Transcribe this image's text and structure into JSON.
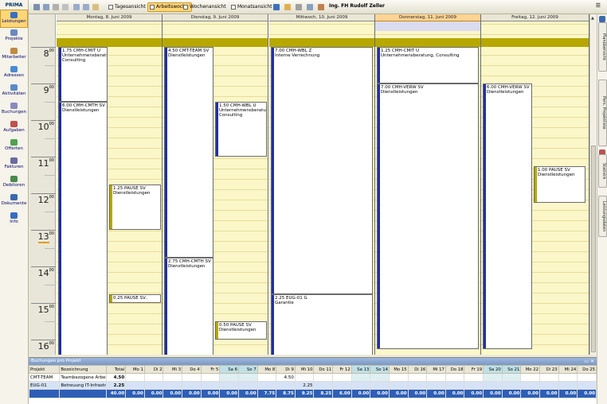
{
  "app": {
    "title": "PRIMA",
    "user": "Ing. FH Rudolf Zeller"
  },
  "sidebar": {
    "items": [
      {
        "label": "Leistungen",
        "icon": "leistungen-icon",
        "selected": true
      },
      {
        "label": "Projekte",
        "icon": "projekte-icon"
      },
      {
        "label": "Mitarbeiter",
        "icon": "mitarbeiter-icon"
      },
      {
        "label": "Adressen",
        "icon": "adressen-icon"
      },
      {
        "label": "Aktivitäten",
        "icon": "aktivitaeten-icon"
      },
      {
        "label": "Buchungen",
        "icon": "buchungen-icon"
      },
      {
        "label": "Aufgaben",
        "icon": "aufgaben-icon"
      },
      {
        "label": "Offerten",
        "icon": "offerten-icon"
      },
      {
        "label": "Fakturen",
        "icon": "fakturen-icon"
      },
      {
        "label": "Debitoren",
        "icon": "debitoren-icon"
      },
      {
        "label": "Dokumente",
        "icon": "dokumente-icon"
      },
      {
        "label": "Info",
        "icon": "info-icon"
      }
    ]
  },
  "toolbar": {
    "views": [
      "Tagesansicht",
      "Arbeitswoche",
      "Wochenansicht",
      "Monatsansicht"
    ],
    "selected_view": "Arbeitswoche",
    "menu_glyph": "☰"
  },
  "calendar": {
    "days": [
      {
        "label": "Montag, 8. Juni 2009",
        "today": false
      },
      {
        "label": "Dienstag, 9. Juni 2009",
        "today": false
      },
      {
        "label": "Mittwoch, 10. Juni 2009",
        "today": false
      },
      {
        "label": "Donnerstag, 11. Juni 2009",
        "today": true
      },
      {
        "label": "Freitag, 12. Juni 2009",
        "today": false
      }
    ],
    "hours": [
      {
        "h": "8",
        "m": "00"
      },
      {
        "h": "9",
        "m": "00"
      },
      {
        "h": "10",
        "m": "00"
      },
      {
        "h": "11",
        "m": "00"
      },
      {
        "h": "12",
        "m": "00"
      },
      {
        "h": "13",
        "m": "00"
      },
      {
        "h": "14",
        "m": "00"
      },
      {
        "h": "15",
        "m": "00"
      },
      {
        "h": "16",
        "m": "00"
      }
    ],
    "current_hour": "13",
    "appointments": [
      {
        "day": 0,
        "sub": 0,
        "start": 8,
        "end": 9.5,
        "title": "1.75 CMH-CMIT U",
        "desc": "Unternehmensberatung, Consulting"
      },
      {
        "day": 0,
        "sub": 0,
        "start": 9.5,
        "end": 16.5,
        "title": "6.00 CMH-CMTH SV",
        "desc": "Dienstleistungen"
      },
      {
        "day": 0,
        "sub": 1,
        "start": 11.75,
        "end": 13.0,
        "title": "1.25 PAUSE SV",
        "desc": "Dienstleistungen",
        "color": "#b6a800"
      },
      {
        "day": 0,
        "sub": 1,
        "start": 14.75,
        "end": 15.0,
        "title": "0.25 PAUSE SV..",
        "desc": "",
        "color": "#b6a800"
      },
      {
        "day": 1,
        "sub": 0,
        "start": 8,
        "end": 13.75,
        "title": "4.50 CMT-TEAM SV",
        "desc": "Dienstleistungen"
      },
      {
        "day": 1,
        "sub": 1,
        "start": 9.5,
        "end": 11.0,
        "title": "1.50 CMH-WBL U",
        "desc": "Unternehmensberatung, Consulting"
      },
      {
        "day": 1,
        "sub": 0,
        "start": 13.75,
        "end": 16.5,
        "title": "2.75 CMH-CMTH SV",
        "desc": "Dienstleistungen"
      },
      {
        "day": 1,
        "sub": 1,
        "start": 15.5,
        "end": 16.0,
        "title": "0.50 PAUSE SV",
        "desc": "Dienstleistungen",
        "color": "#b6a800"
      },
      {
        "day": 2,
        "sub": 0,
        "start": 8,
        "end": 14.75,
        "title": "7.00 CMH-WBL Z",
        "desc": "Interne Verrechnung"
      },
      {
        "day": 2,
        "sub": 0,
        "start": 14.75,
        "end": 16.5,
        "title": "2.25 EUG-01 G",
        "desc": "Garantie"
      },
      {
        "day": 3,
        "sub": 0,
        "start": 8,
        "end": 9.0,
        "title": "1.25 CMH-CMIT U",
        "desc": "Unternehmensberatung, Consulting"
      },
      {
        "day": 3,
        "sub": 0,
        "start": 9.0,
        "end": 16.25,
        "title": "7.00 CMH-VERW SV",
        "desc": "Dienstleistungen"
      },
      {
        "day": 4,
        "sub": 0,
        "start": 9.0,
        "end": 16.25,
        "title": "6.00 CMH-VERW SV",
        "desc": "Dienstleistungen"
      },
      {
        "day": 4,
        "sub": 1,
        "start": 11.25,
        "end": 12.25,
        "title": "1.00 PAUSE SV",
        "desc": "Dienstleistungen",
        "color": "#b6a800"
      }
    ]
  },
  "right_tabs": [
    "Planübersicht",
    "Pers. Projektliste",
    "Statistik",
    "Leistungsdaten"
  ],
  "bottom": {
    "title": "Buchungen pro Projekt",
    "controls": "▭ ✕",
    "columns": [
      "Projekt",
      "Bezeichnung",
      "Total",
      "Mo 1",
      "Di 2",
      "Mi 3",
      "Do 4",
      "Fr 5",
      "Sa 6",
      "So 7",
      "Mo 8",
      "Di 9",
      "Mi 10",
      "Do 11",
      "Fr 12",
      "Sa 13",
      "So 14",
      "Mo 15",
      "Di 16",
      "Mi 17",
      "Do 18",
      "Fr 19",
      "Sa 20",
      "So 21",
      "Mo 22",
      "Di 23",
      "Mi 24",
      "Do 25"
    ],
    "weekend_cols": [
      8,
      9,
      15,
      16,
      22,
      23
    ],
    "rows": [
      {
        "cells": [
          "CMT-TEAM",
          "Teambezogene Arbeiten d...",
          "4.50",
          "",
          "",
          "",
          "",
          "",
          "",
          "",
          "",
          "4.50",
          "",
          "",
          "",
          "",
          "",
          "",
          "",
          "",
          "",
          "",
          "",
          "",
          "",
          "",
          "",
          ""
        ]
      },
      {
        "selected": true,
        "cells": [
          "EUG-01",
          "Betreuung IT-Infrastruktur",
          "2.25",
          "",
          "",
          "",
          "",
          "",
          "",
          "",
          "",
          "",
          "2.25",
          "",
          "",
          "",
          "",
          "",
          "",
          "",
          "",
          "",
          "",
          "",
          "",
          "",
          "",
          ""
        ]
      }
    ],
    "totals": [
      "",
      "",
      "40.00",
      "0.00",
      "0.00",
      "0.00",
      "0.00",
      "0.00",
      "0.00",
      "0.00",
      "7.75",
      "8.75",
      "9.25",
      "8.25",
      "6.00",
      "0.00",
      "0.00",
      "0.00",
      "0.00",
      "0.00",
      "0.00",
      "0.00",
      "0.00",
      "0.00",
      "0.00",
      "0.00",
      "0.00",
      "0.00"
    ]
  }
}
